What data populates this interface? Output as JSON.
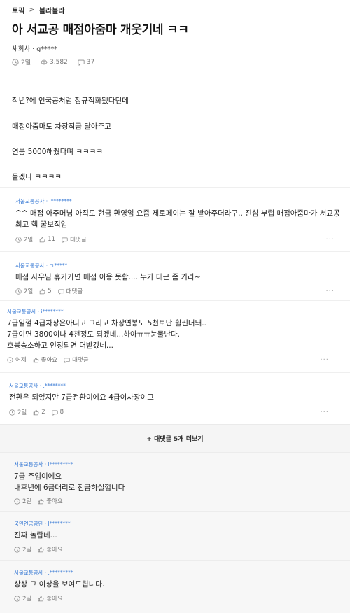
{
  "breadcrumb": {
    "section": "토픽",
    "separator": ">",
    "board": "블라블라"
  },
  "post": {
    "title": "아 서교공 매점아줌마 개웃기네 ㅋㅋ",
    "author": "새회사 · g*****",
    "time": "2일",
    "views": "3,582",
    "comments": "37",
    "body": [
      "작년?에 인국공처럼 정규직화됐다던데",
      "매점아줌마도 차장직급 달아주고",
      "연봉 5000해줬다며 ㅋㅋㅋㅋ",
      "들겠다 ㅋㅋㅋㅋ"
    ]
  },
  "comments": [
    {
      "author": "서울교통공사 · l********",
      "lines": [
        "^^ 매점 아주머님 아직도 현금 환영임 요즘 제로페이는 잘 받아주더라구.. 진심 부럽 매점아줌마가 서교공",
        "최고 핵 꿀보직임"
      ],
      "time": "2일",
      "likes": "11",
      "reply_label": "대댓글",
      "more": "..."
    },
    {
      "author": "서울교통공사 · ㄱ*****",
      "lines": [
        "매점 사우님 휴가가면 매점 이용 못함.... 누가 대근 좀 가라~"
      ],
      "time": "2일",
      "likes": "5",
      "reply_label": "대댓글",
      "more": "..."
    },
    {
      "author": "서울교통공사 · i********",
      "lines": [
        "7급일껄 4급차장은아니고 그리고 차장연봉도 5천보단 훨씬더돼..",
        "7급이면 3800이나 4천정도 되겠네...하아ㅠㅠ눈물난다.",
        "호봉승소하고 인정되면 더받겠네..."
      ],
      "time": "어제",
      "likes": "좋아요",
      "reply_label": "대댓글",
      "more": "..."
    },
    {
      "author": "서울교통공사 · .********",
      "lines": [
        "전환은 되었지만 7급전환이에요 4급이차장이고"
      ],
      "time": "2일",
      "likes": "2",
      "reply_count": "8",
      "more": "..."
    }
  ],
  "more_replies": "+ 대댓글 5개 더보기",
  "replies": [
    {
      "author": "서울교통공사 · l*********",
      "lines": [
        "7급 주임이에요",
        "내후년에 6급대리로 진급하실껍니다"
      ],
      "time": "2일",
      "likes": "좋아요"
    },
    {
      "author": "국민연금공단 · l********",
      "lines": [
        "진짜 놀랍네..."
      ],
      "time": "2일",
      "likes": "좋아요"
    },
    {
      "author": "서울교통공사 · .*********",
      "lines": [
        "상상 그 이상을 보여드립니다."
      ],
      "time": "2일",
      "likes": "좋아요"
    }
  ],
  "colors": {
    "author_link": "#3a7bd5",
    "meta": "#777777",
    "reply_bg": "#f7f7f7"
  },
  "icons": {
    "clock": "clock-icon",
    "eye": "eye-icon",
    "chat": "chat-bubble-icon",
    "thumb": "thumbs-up-icon"
  }
}
